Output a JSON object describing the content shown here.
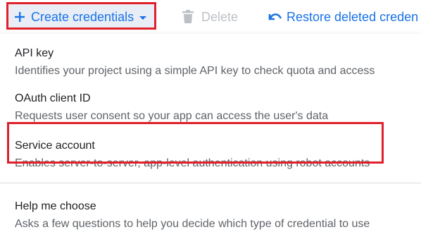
{
  "toolbar": {
    "create_label": "Create credentials",
    "delete_label": "Delete",
    "restore_label": "Restore deleted creden"
  },
  "menu": {
    "items": [
      {
        "title": "API key",
        "description": "Identifies your project using a simple API key to check quota and access"
      },
      {
        "title": "OAuth client ID",
        "description": "Requests user consent so your app can access the user's data"
      },
      {
        "title": "Service account",
        "description": "Enables server-to-server, app-level authentication using robot accounts"
      },
      {
        "title": "Help me choose",
        "description": "Asks a few questions to help you decide which type of credential to use"
      }
    ]
  },
  "colors": {
    "accent": "#1a73e8",
    "highlight": "#e0202a",
    "disabled": "#bdc1c6",
    "text_primary": "#202124",
    "text_secondary": "#5f6368"
  },
  "icons": {
    "create": "plus-icon",
    "create_caret": "caret-down-icon",
    "delete": "trash-icon",
    "restore": "undo-icon"
  }
}
